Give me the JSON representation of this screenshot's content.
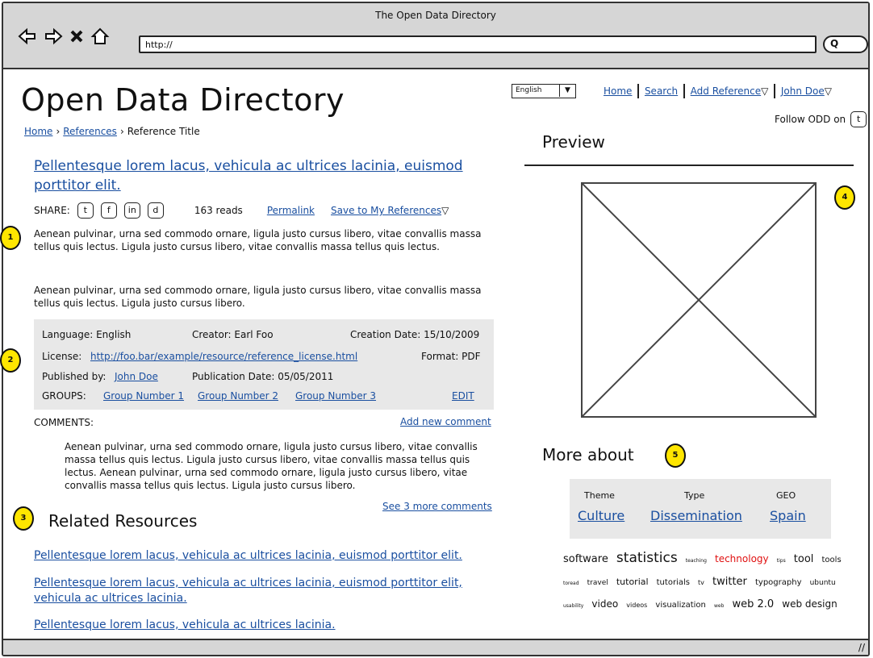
{
  "window": {
    "title": "The Open Data Directory",
    "url": "http://"
  },
  "site": {
    "title": "Open Data Directory",
    "breadcrumb": [
      "Home",
      "References",
      "Reference Title"
    ],
    "language": "English"
  },
  "nav": {
    "home": "Home",
    "search": "Search",
    "add_reference": "Add Reference",
    "user": "John Doe",
    "follow": "Follow ODD on"
  },
  "resource": {
    "title": "Pellentesque lorem lacus, vehicula ac ultrices lacinia, euismod porttitor elit.",
    "share_label": "SHARE:",
    "reads": "163 reads",
    "permalink": "Permalink",
    "save": "Save to My References",
    "paragraphs": [
      "Aenean pulvinar, urna sed commodo ornare, ligula justo cursus libero, vitae convallis massa tellus quis lectus. Ligula justo cursus libero, vitae convallis massa tellus quis lectus.",
      "Aenean pulvinar, urna sed commodo ornare, ligula justo cursus libero, vitae convallis massa tellus quis lectus. Ligula justo cursus libero."
    ]
  },
  "meta": {
    "language": "Language: English",
    "creator": "Creator: Earl Foo",
    "creation_date": "Creation Date: 15/10/2009",
    "license_label": "License:",
    "license_link": "http://foo.bar/example/resource/reference_license.html",
    "format": "Format: PDF",
    "published_label": "Published by:",
    "published_by": "John Doe",
    "publication_date": "Publication Date: 05/05/2011",
    "groups_label": "GROUPS:",
    "groups": [
      "Group Number 1",
      "Group Number 2",
      "Group Number 3"
    ],
    "edit": "EDIT"
  },
  "comments": {
    "label": "COMMENTS:",
    "add": "Add new comment",
    "text": "Aenean pulvinar, urna sed commodo ornare, ligula justo cursus libero, vitae convallis massa tellus quis lectus. Ligula justo cursus libero, vitae convallis massa tellus quis lectus. Aenean pulvinar, urna sed commodo ornare, ligula justo cursus libero, vitae convallis massa tellus quis lectus. Ligula justo cursus libero.",
    "more": "See 3 more comments"
  },
  "related": {
    "title": "Related Resources",
    "links": [
      "Pellentesque lorem lacus, vehicula ac ultrices lacinia, euismod porttitor elit.",
      "Pellentesque lorem lacus, vehicula ac ultrices lacinia, euismod porttitor elit, vehicula ac ultrices lacinia.",
      "Pellentesque lorem lacus, vehicula ac ultrices lacinia."
    ]
  },
  "preview": {
    "title": "Preview"
  },
  "more_about": {
    "title": "More about",
    "labels": [
      "Theme",
      "Type",
      "GEO"
    ],
    "values": [
      "Culture",
      "Dissemination",
      "Spain"
    ]
  },
  "tags": [
    {
      "t": "software",
      "s": 13
    },
    {
      "t": "statistics",
      "s": 17
    },
    {
      "t": "teaching",
      "s": 6
    },
    {
      "t": "technology",
      "s": 12,
      "c": "#e01010"
    },
    {
      "t": "tips",
      "s": 6
    },
    {
      "t": "tool",
      "s": 13
    },
    {
      "t": "tools",
      "s": 10
    },
    {
      "t": "toread",
      "s": 6
    },
    {
      "t": "travel",
      "s": 9
    },
    {
      "t": "tutorial",
      "s": 11
    },
    {
      "t": "tutorials",
      "s": 10
    },
    {
      "t": "tv",
      "s": 8
    },
    {
      "t": "twitter",
      "s": 13
    },
    {
      "t": "typography",
      "s": 10
    },
    {
      "t": "ubuntu",
      "s": 9
    },
    {
      "t": "usability",
      "s": 6
    },
    {
      "t": "video",
      "s": 12
    },
    {
      "t": "videos",
      "s": 8
    },
    {
      "t": "visualization",
      "s": 10
    },
    {
      "t": "web",
      "s": 6
    },
    {
      "t": "web 2.0",
      "s": 13
    },
    {
      "t": "web design",
      "s": 12
    }
  ],
  "markers": [
    "1",
    "2",
    "3",
    "4",
    "5"
  ],
  "icons": {
    "share": [
      "twitter-icon",
      "facebook-icon",
      "linkedin-icon",
      "delicious-icon"
    ],
    "share_glyphs": [
      "t",
      "f",
      "in",
      "d"
    ]
  }
}
